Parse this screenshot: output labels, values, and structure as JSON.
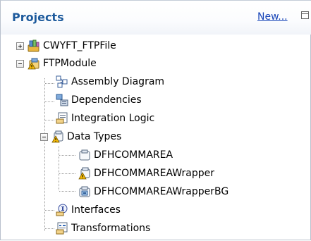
{
  "header": {
    "title": "Projects",
    "new_link": "New..."
  },
  "tree": {
    "items": [
      {
        "label": "CWYFT_FTPFile",
        "icon": "library-project-icon",
        "state": "collapsed"
      },
      {
        "label": "FTPModule",
        "icon": "module-project-warning-icon",
        "state": "expanded"
      },
      {
        "label": "Assembly Diagram",
        "icon": "assembly-diagram-icon"
      },
      {
        "label": "Dependencies",
        "icon": "dependencies-icon"
      },
      {
        "label": "Integration Logic",
        "icon": "integration-logic-icon"
      },
      {
        "label": "Data Types",
        "icon": "data-types-warning-icon",
        "state": "expanded"
      },
      {
        "label": "DFHCOMMAREA",
        "icon": "business-object-icon"
      },
      {
        "label": "DFHCOMMAREAWrapper",
        "icon": "business-object-warning-icon"
      },
      {
        "label": "DFHCOMMAREAWrapperBG",
        "icon": "business-graph-icon"
      },
      {
        "label": "Interfaces",
        "icon": "interfaces-icon"
      },
      {
        "label": "Transformations",
        "icon": "transformations-icon"
      }
    ]
  },
  "colors": {
    "title": "#1d5a9c",
    "link": "#1a47b8",
    "warning": "#f2b705"
  }
}
